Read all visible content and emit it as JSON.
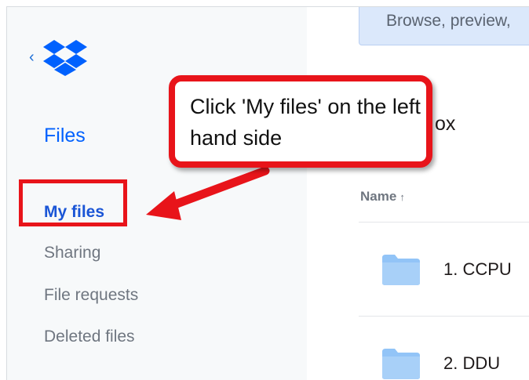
{
  "banner": {
    "text": "Browse, preview,"
  },
  "sidebar": {
    "back_icon": "chevron-left-icon",
    "logo_icon": "dropbox-logo-icon",
    "heading": "Files",
    "items": [
      {
        "label": "My files",
        "active": true
      },
      {
        "label": "Sharing",
        "active": false
      },
      {
        "label": "File requests",
        "active": false
      },
      {
        "label": "Deleted files",
        "active": false
      }
    ]
  },
  "main": {
    "partial_title": "ox",
    "column_name": "Name",
    "sort_icon": "arrow-up-icon",
    "rows": [
      {
        "icon": "folder-icon",
        "name": "1. CCPU"
      },
      {
        "icon": "folder-icon",
        "name": "2. DDU"
      }
    ]
  },
  "annotation": {
    "callout_text": "Click 'My files' on the left hand side",
    "highlight_color": "#e8141a"
  },
  "colors": {
    "accent_blue": "#0061fe",
    "folder_blue": "#92c4f7",
    "sidebar_bg": "#f7f9fa",
    "banner_bg": "#dbe8fb"
  }
}
